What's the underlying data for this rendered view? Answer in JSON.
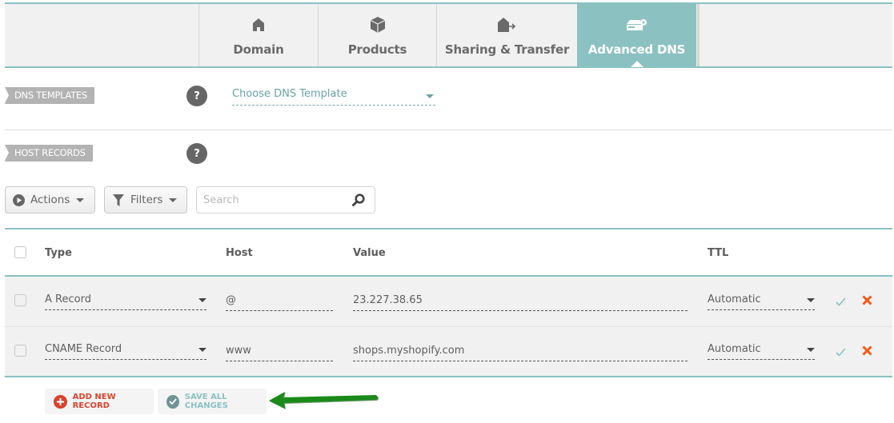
{
  "tabs": [
    {
      "label": "Domain",
      "icon": "home-icon",
      "active": false
    },
    {
      "label": "Products",
      "icon": "box-icon",
      "active": false
    },
    {
      "label": "Sharing & Transfer",
      "icon": "home-transfer-icon",
      "active": false
    },
    {
      "label": "Advanced DNS",
      "icon": "server-gear-icon",
      "active": true
    }
  ],
  "dns_templates": {
    "section_label": "DNS TEMPLATES",
    "help": "?",
    "select_value": "Choose DNS Template"
  },
  "host_records": {
    "section_label": "HOST RECORDS",
    "help": "?"
  },
  "toolbar": {
    "actions_label": "Actions",
    "filters_label": "Filters",
    "search_placeholder": "Search",
    "search_value": ""
  },
  "table": {
    "columns": [
      "Type",
      "Host",
      "Value",
      "TTL"
    ],
    "rows": [
      {
        "type": "A Record",
        "host": "@",
        "value": "23.227.38.65",
        "ttl": "Automatic"
      },
      {
        "type": "CNAME Record",
        "host": "www",
        "value": "shops.myshopify.com",
        "ttl": "Automatic"
      }
    ]
  },
  "footer": {
    "add_label": "ADD NEW RECORD",
    "save_label": "SAVE ALL CHANGES"
  },
  "colors": {
    "accent": "#8bc1c1",
    "delete": "#f05a16",
    "add": "#d8432f",
    "annotation_arrow": "#1a8a1a"
  }
}
